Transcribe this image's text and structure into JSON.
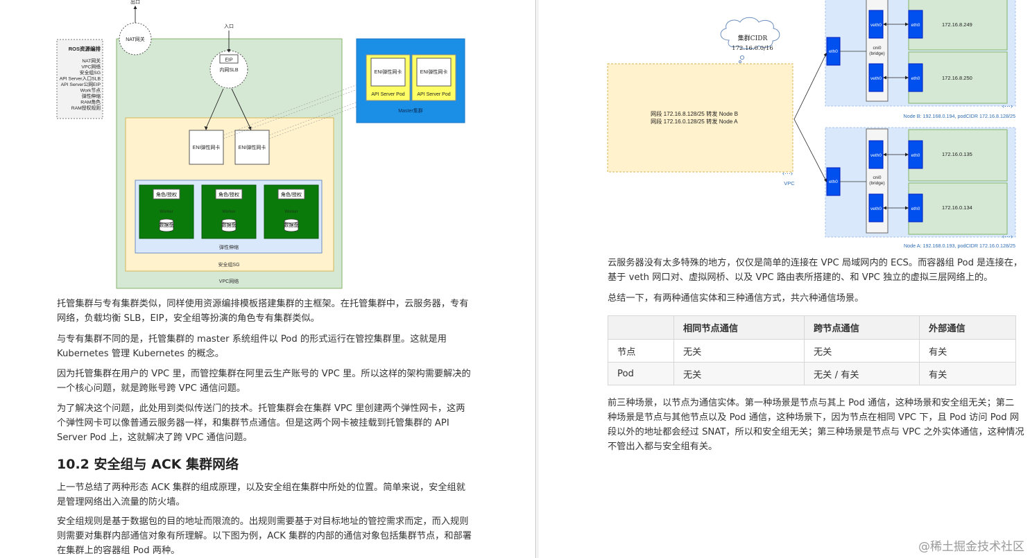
{
  "left": {
    "diagram": {
      "exit_label": "出口",
      "nat_label": "NAT网关",
      "entry_label": "入口",
      "eip_label": "EIP",
      "slb_label": "内网SLB",
      "ros_title": "ROS资源编排",
      "ros_items": [
        "NAT网关",
        "VPC网络",
        "安全组SG",
        "API Server入口SLB",
        "API Server公网EIP",
        "Work节点",
        "弹性伸缩",
        "RAM角色",
        "RAM授权规则"
      ],
      "eni_label": "ENI弹性网卡",
      "api_pod_label": "API Server Pod",
      "master_label": "Master集群",
      "role_label": "角色/授权",
      "worker_label": "Worker",
      "disk_label": "数据盘",
      "scaling_label": "弹性伸缩",
      "sg_label": "安全组SG",
      "vpc_label": "VPC网络"
    },
    "paragraphs": [
      [
        "托管集群与专有集群类似，同样使用资源编排模板搭建集群的主框架。在托管集群中，云服务器，专有",
        "网络，负载均衡 SLB，EIP，安全组等扮演的角色专有集群类似。"
      ],
      [
        "与专有集群不同的是，托管集群的 master 系统组件以 Pod 的形式运行在管控集群里。这就是用",
        "Kubernetes 管理 Kubernetes 的概念。"
      ],
      [
        "因为托管集群在用户的 VPC 里，而管控集群在阿里云生产账号的 VPC 里。所以这样的架构需要解决的",
        "一个核心问题，就是跨账号跨 VPC 通信问题。"
      ],
      [
        "为了解决这个问题，此处用到类似传送门的技术。托管集群会在集群 VPC 里创建两个弹性网卡，这两",
        "个弹性网卡可以像普通云服务器一样，和集群节点通信。但是这两个网卡被挂载到托管集群的 API",
        "Server Pod 上，这就解决了跨 VPC 通信问题。"
      ]
    ],
    "heading": "10.2 安全组与 ACK 集群网络",
    "paragraphs2": [
      [
        "上一节总结了两种形态 ACK 集群的组成原理，以及安全组在集群中所处的位置。简单来说，安全组就",
        "是管理网络出入流量的防火墙。"
      ],
      [
        "安全组规则是基于数据包的目的地址而限流的。出规则需要基于对目标地址的管控需求而定，而入规则",
        "则需要对集群内部通信对象有所理解。以下图为例，ACK 集群的内部的通信对象包括集群节点，和部署",
        "在集群上的容器组 Pod 两种。"
      ]
    ]
  },
  "right": {
    "diagram": {
      "cloud_line1": "集群CIDR",
      "cloud_line2": "172.16.0.0/16",
      "route_line1": "网段 172.16.8.128/25 转发 Node B",
      "route_line2": "网段 172.16.0.128/25 转发 Node A",
      "vpc_label": "VPC",
      "eth0": "eth0",
      "veth0": "veth0",
      "cni_line1": "cni0",
      "cni_line2": "(bridge)",
      "pod_ips_b": [
        "172.16.8.249",
        "172.16.8.250"
      ],
      "pod_ips_a": [
        "172.16.0.135",
        "172.16.0.134"
      ],
      "node_b_label": "Node B: 192.168.0.194, podCIDR 172.16.8.128/25",
      "node_a_label": "Node A: 192.168.0.193, podCIDR 172.16.0.128/25"
    },
    "paragraph1": [
      "云服务器没有太多特殊的地方，仅仅是简单的连接在 VPC 局域网内的 ECS。而容器组 Pod 是连接在，",
      "基于 veth 网口对、虚拟网桥、以及 VPC 路由表所搭建的、和 VPC 独立的虚拟三层网络上的。"
    ],
    "paragraph2": [
      "总结一下，有两种通信实体和三种通信方式，共六种通信场景。"
    ],
    "table": {
      "headers": [
        "",
        "相同节点通信",
        "跨节点通信",
        "外部通信"
      ],
      "rows": [
        [
          "节点",
          "无关",
          "无关",
          "有关"
        ],
        [
          "Pod",
          "无关",
          "无关 / 有关",
          "有关"
        ]
      ]
    },
    "paragraph3": [
      "前三种场景，以节点为通信实体。第一种场景是节点与其上 Pod 通信，这种场景和安全组无关；第二",
      "种场景是节点与其他节点以及 Pod 通信，这种场景下，因为节点在相同 VPC 下，且 Pod 访问 Pod 网",
      "段以外的地址都会经过 SNAT，所以和安全组无关；第三种场景是节点与 VPC 之外实体通信，这种情况",
      "不管出入都与安全组有关。"
    ]
  },
  "watermark": "@稀土掘金技术社区"
}
